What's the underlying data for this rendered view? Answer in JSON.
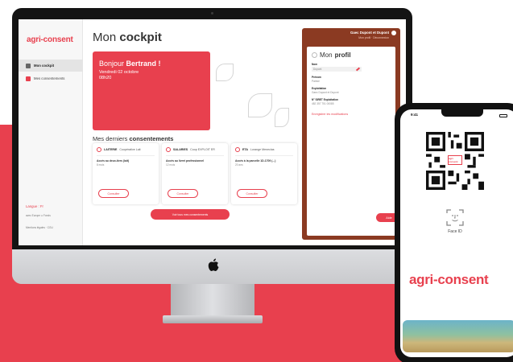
{
  "colors": {
    "accent": "#e8404e",
    "profile_panel": "#8b3a22"
  },
  "app": {
    "logo": "agri-consent"
  },
  "sidebar": {
    "items": [
      {
        "label": "Mon cockpit",
        "icon": "home-icon",
        "active": true
      },
      {
        "label": "Mes consentements",
        "icon": "checklist-icon",
        "active": false
      }
    ],
    "language": "Langue : Fr",
    "partners": "avec Europe ▪▪ Fonds",
    "footer": "Mentions légales · CGU"
  },
  "page": {
    "title_light": "Mon",
    "title_bold": "cockpit"
  },
  "welcome": {
    "greeting_prefix": "Bonjour",
    "user_name": "Bertrand !",
    "date": "Vendredi 02 octobre",
    "time": "08h20"
  },
  "consents": {
    "section_title_light": "Mes derniers",
    "section_title_bold": "consentements",
    "cards": [
      {
        "type": "LAITERIE",
        "org": "Coopérative Lait",
        "desc": "Accès au deux-tiers (lait)",
        "sub": "8 mois",
        "button": "Consulter"
      },
      {
        "type": "SALARIES",
        "org": "Coop EXPLOIT ER",
        "desc": "Accès au livret professionnel",
        "sub": "12 mois",
        "button": "Consulter"
      },
      {
        "type": "ETA",
        "org": "Lorange Meneclas",
        "desc": "Accès à la parcelle 1D-1709 (...)",
        "sub": "20 ans",
        "button": "Consulter"
      }
    ],
    "cta": "Voir tous mes consentements"
  },
  "profile": {
    "account_name": "Gaec Dupont et Dupont",
    "account_links": "Mon profil · Déconnexion",
    "title_light": "Mon",
    "title_bold": "profil",
    "fields": [
      {
        "label": "Nom",
        "value": "Dupont",
        "editable": true
      },
      {
        "label": "Prénom",
        "value": "Patrice"
      },
      {
        "label": "Exploitation",
        "value": "Gaec Dupont et Dupont"
      },
      {
        "label": "N° SIRET Exploitation",
        "value": "482 357 751 00085"
      }
    ],
    "save": "Enregistrer les modifications",
    "help": "Aide"
  },
  "phone": {
    "time": "9:41",
    "qr_logo": "agri-consent",
    "face_id": "Face ID",
    "logo": "agri-consent"
  }
}
